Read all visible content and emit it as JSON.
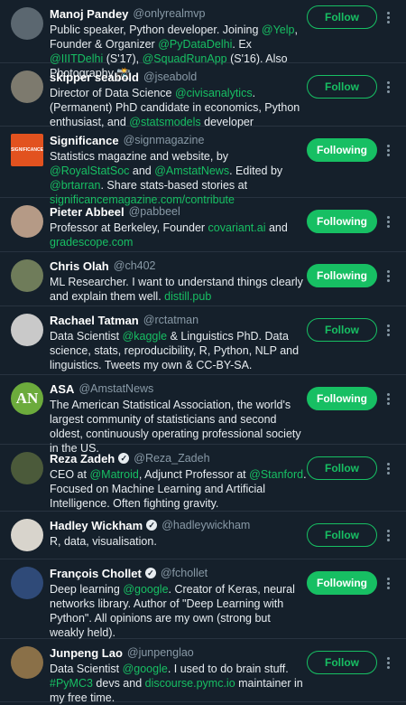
{
  "accounts": [
    {
      "name": "Manoj Pandey",
      "handle": "@onlyrealmvp",
      "verified": false,
      "avatar": {
        "color": "#5b6770",
        "letters": ""
      },
      "button": "Follow",
      "following": false,
      "bio": [
        {
          "t": "Public speaker, Python developer. Joining "
        },
        {
          "t": "@Yelp",
          "link": true
        },
        {
          "t": ", Founder & Organizer "
        },
        {
          "t": "@PyDataDelhi",
          "link": true
        },
        {
          "t": ". Ex "
        },
        {
          "t": "@IIITDelhi",
          "link": true
        },
        {
          "t": " (S'17), "
        },
        {
          "t": "@SquadRunApp",
          "link": true
        },
        {
          "t": " (S'16). Also Photography 📸"
        }
      ]
    },
    {
      "name": "skipper seabold",
      "handle": "@jseabold",
      "verified": false,
      "avatar": {
        "color": "#7d7a6e",
        "letters": ""
      },
      "button": "Follow",
      "following": false,
      "bio": [
        {
          "t": "Director of Data Science "
        },
        {
          "t": "@civisanalytics",
          "link": true
        },
        {
          "t": ". (Permanent) PhD candidate in economics, Python enthusiast, and "
        },
        {
          "t": "@statsmodels",
          "link": true
        },
        {
          "t": " developer"
        }
      ]
    },
    {
      "name": "Significance",
      "handle": "@signmagazine",
      "verified": false,
      "avatar": {
        "color": "#e2521f",
        "letters": "SIGNIFICANCE"
      },
      "button": "Following",
      "following": true,
      "bio": [
        {
          "t": "Statistics magazine and website, by "
        },
        {
          "t": "@RoyalStatSoc",
          "link": true
        },
        {
          "t": " and "
        },
        {
          "t": "@AmstatNews",
          "link": true
        },
        {
          "t": ". Edited by "
        },
        {
          "t": "@brtarran",
          "link": true
        },
        {
          "t": ". Share stats-based stories at "
        },
        {
          "t": "significancemagazine.com/contribute",
          "link": true
        }
      ]
    },
    {
      "name": "Pieter Abbeel",
      "handle": "@pabbeel",
      "verified": false,
      "avatar": {
        "color": "#b59a86",
        "letters": ""
      },
      "button": "Following",
      "following": true,
      "bio": [
        {
          "t": "Professor at Berkeley, Founder "
        },
        {
          "t": "covariant.ai",
          "link": true
        },
        {
          "t": " and "
        },
        {
          "t": "gradescope.com",
          "link": true
        }
      ]
    },
    {
      "name": "Chris Olah",
      "handle": "@ch402",
      "verified": false,
      "avatar": {
        "color": "#6f7c5a",
        "letters": ""
      },
      "button": "Following",
      "following": true,
      "bio": [
        {
          "t": "ML Researcher. I want to understand things clearly and explain them well. "
        },
        {
          "t": "distill.pub",
          "link": true
        }
      ]
    },
    {
      "name": "Rachael Tatman",
      "handle": "@rctatman",
      "verified": false,
      "avatar": {
        "color": "#c9c9c9",
        "letters": ""
      },
      "button": "Follow",
      "following": false,
      "bio": [
        {
          "t": "Data Scientist "
        },
        {
          "t": "@kaggle",
          "link": true
        },
        {
          "t": " & Linguistics PhD. Data science, stats, reproducibility, R, Python, NLP and linguistics. Tweets my own & CC-BY-SA."
        }
      ]
    },
    {
      "name": "ASA",
      "handle": "@AmstatNews",
      "verified": false,
      "avatar": {
        "color": "#6cab3c",
        "letters": "AN"
      },
      "button": "Following",
      "following": true,
      "bio": [
        {
          "t": "The American Statistical Association, the world's largest community of statisticians and second oldest, continuously operating professional society in the US."
        }
      ]
    },
    {
      "name": "Reza Zadeh",
      "handle": "@Reza_Zadeh",
      "verified": true,
      "avatar": {
        "color": "#4b5a3a",
        "letters": ""
      },
      "button": "Follow",
      "following": false,
      "bio": [
        {
          "t": "CEO at "
        },
        {
          "t": "@Matroid",
          "link": true
        },
        {
          "t": ", Adjunct Professor at "
        },
        {
          "t": "@Stanford",
          "link": true
        },
        {
          "t": ". Focused on Machine Learning and Artificial Intelligence. Often fighting gravity."
        }
      ]
    },
    {
      "name": "Hadley Wickham",
      "handle": "@hadleywickham",
      "verified": true,
      "avatar": {
        "color": "#d8d4cc",
        "letters": ""
      },
      "button": "Follow",
      "following": false,
      "bio": [
        {
          "t": "R, data, visualisation."
        }
      ]
    },
    {
      "name": "François Chollet",
      "handle": "@fchollet",
      "verified": true,
      "avatar": {
        "color": "#2f4a78",
        "letters": ""
      },
      "button": "Following",
      "following": true,
      "bio": [
        {
          "t": "Deep learning "
        },
        {
          "t": "@google",
          "link": true
        },
        {
          "t": ". Creator of Keras, neural networks library. Author of \"Deep Learning with Python\". All opinions are my own (strong but weakly held)."
        }
      ]
    },
    {
      "name": "Junpeng Lao",
      "handle": "@junpenglao",
      "verified": false,
      "avatar": {
        "color": "#8a7048",
        "letters": ""
      },
      "button": "Follow",
      "following": false,
      "bio": [
        {
          "t": "Data Scientist "
        },
        {
          "t": "@google",
          "link": true
        },
        {
          "t": ". I used to do brain stuff. "
        },
        {
          "t": "#PyMC3",
          "link": true
        },
        {
          "t": " devs and "
        },
        {
          "t": "discourse.pymc.io",
          "link": true
        },
        {
          "t": " maintainer in my free time."
        }
      ]
    }
  ]
}
